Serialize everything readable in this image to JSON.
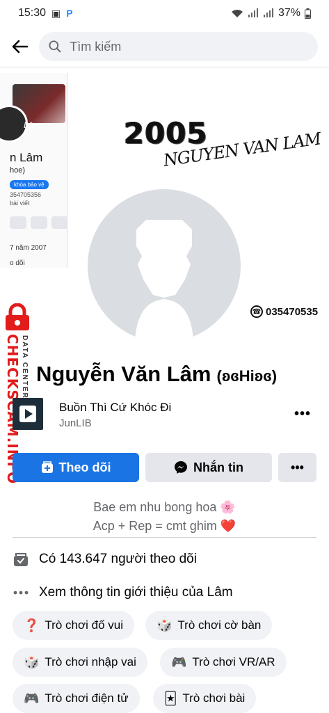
{
  "status_bar": {
    "time": "15:30",
    "battery": "37%"
  },
  "search": {
    "placeholder": "Tìm kiếm"
  },
  "cover": {
    "year": "2005",
    "signature": "NGUYEN VAN LAM",
    "phone": "035470535",
    "phone_preview": {
      "name": "n Lâm",
      "nick": "hoe)",
      "lock_label": "khóa bảo vệ",
      "phone": "354705356",
      "posts": "bài viết",
      "date": "7 năm 2007",
      "follow": "o dõi",
      "pic_label": "Lâm"
    }
  },
  "watermark": {
    "main": "CHECKSCAM.INFO",
    "sub": "DATA CENTER"
  },
  "profile": {
    "name": "Nguyễn Văn Lâm",
    "nickname": "(ʚɞHiʚɞ)"
  },
  "music": {
    "title": "Buồn Thì Cứ Khóc Đi",
    "artist": "JunLIB",
    "more": "•••"
  },
  "actions": {
    "follow": "Theo dõi",
    "message": "Nhắn tin",
    "more": "•••"
  },
  "bio": {
    "line1": "Bae em nhu bong hoa 🌸",
    "line2": "Acp + Rep = cmt ghim ❤️"
  },
  "info": {
    "followers": "Có 143.647 người theo dõi",
    "about": "Xem thông tin giới thiệu của Lâm"
  },
  "chips": [
    {
      "emoji": "❓",
      "label": "Trò chơi đố vui"
    },
    {
      "emoji": "🎲",
      "label": "Trò chơi cờ bàn"
    },
    {
      "emoji": "🎲",
      "label": "Trò chơi nhập vai"
    },
    {
      "emoji": "🎮",
      "label": "Trò chơi VR/AR"
    },
    {
      "emoji": "🎮",
      "label": "Trò chơi điện tử"
    },
    {
      "emoji": "🃏",
      "label": "Trò chơi bài"
    }
  ],
  "colors": {
    "primary": "#1b74e4",
    "watermark": "#e21b1b"
  }
}
